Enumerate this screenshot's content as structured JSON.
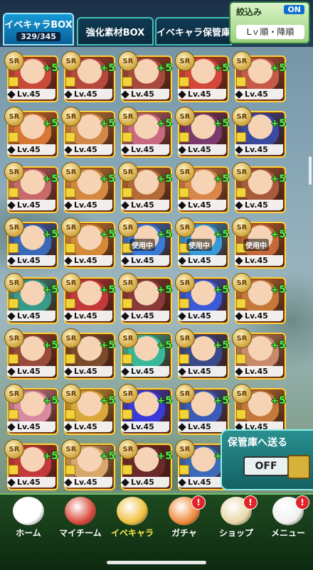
{
  "tabs": {
    "event_box": {
      "label": "イベキャラBOX",
      "count": "329/345"
    },
    "material_box": {
      "label": "強化素材BOX"
    },
    "storage": {
      "label": "イベキャラ保管庫"
    }
  },
  "filter": {
    "label": "絞込み",
    "state": "ON",
    "sort": "Lｖ順・降順"
  },
  "grid": {
    "rank_label": "SR",
    "plus_label": "+5",
    "level_label": "Lv.45",
    "in_use_label": "使用中",
    "cards": [
      {
        "color": "#c94a3a"
      },
      {
        "color": "#b6493b"
      },
      {
        "color": "#a94b3c"
      },
      {
        "color": "#d4463a"
      },
      {
        "color": "#c55a48"
      },
      {
        "color": "#d87836"
      },
      {
        "color": "#d18a4a"
      },
      {
        "color": "#c86a80"
      },
      {
        "color": "#7a3a6e"
      },
      {
        "color": "#3a4aa0"
      },
      {
        "color": "#c86a6a"
      },
      {
        "color": "#d38a40"
      },
      {
        "color": "#b56a3a"
      },
      {
        "color": "#d8864a"
      },
      {
        "color": "#a85a3a"
      },
      {
        "color": "#3a6ab8",
        "in_use": false
      },
      {
        "color": "#d58a3a"
      },
      {
        "color": "#3a7ad8",
        "in_use": true
      },
      {
        "color": "#3a9ad8",
        "in_use": true
      },
      {
        "color": "#c46a3a",
        "in_use": true
      },
      {
        "color": "#3a9a8a"
      },
      {
        "color": "#c43a3a"
      },
      {
        "color": "#8a3a3a"
      },
      {
        "color": "#3a5ad8"
      },
      {
        "color": "#c4783a"
      },
      {
        "color": "#9a4a3a"
      },
      {
        "color": "#7a4a2a"
      },
      {
        "color": "#3ab89a"
      },
      {
        "color": "#3a4a88"
      },
      {
        "color": "#c88a6a"
      },
      {
        "color": "#d88aa0"
      },
      {
        "color": "#d8a83a"
      },
      {
        "color": "#3a3ad8"
      },
      {
        "color": "#3a5ab8"
      },
      {
        "color": "#c4783a"
      },
      {
        "color": "#c43a3a"
      },
      {
        "color": "#d8a86a"
      },
      {
        "color": "#6a2a2a"
      },
      {
        "color": "#3a6ab8"
      },
      {
        "color": "#c8a04a"
      }
    ]
  },
  "send_panel": {
    "title": "保管庫へ送る",
    "toggle": "OFF"
  },
  "nav": [
    {
      "label": "ホーム",
      "icon": "soccer-ball-icon",
      "color": "#ffffff",
      "badge": ""
    },
    {
      "label": "マイチーム",
      "icon": "team-icon",
      "color": "#d94a3a",
      "badge": ""
    },
    {
      "label": "イベキャラ",
      "icon": "event-chara-icon",
      "color": "#f0c040",
      "badge": ""
    },
    {
      "label": "ガチャ",
      "icon": "gacha-icon",
      "color": "#f08a3a",
      "badge": "!"
    },
    {
      "label": "ショップ",
      "icon": "shop-icon",
      "color": "#e8d8a8",
      "badge": "!"
    },
    {
      "label": "メニュー",
      "icon": "menu-icon",
      "color": "#f0f0f0",
      "badge": "!"
    }
  ]
}
